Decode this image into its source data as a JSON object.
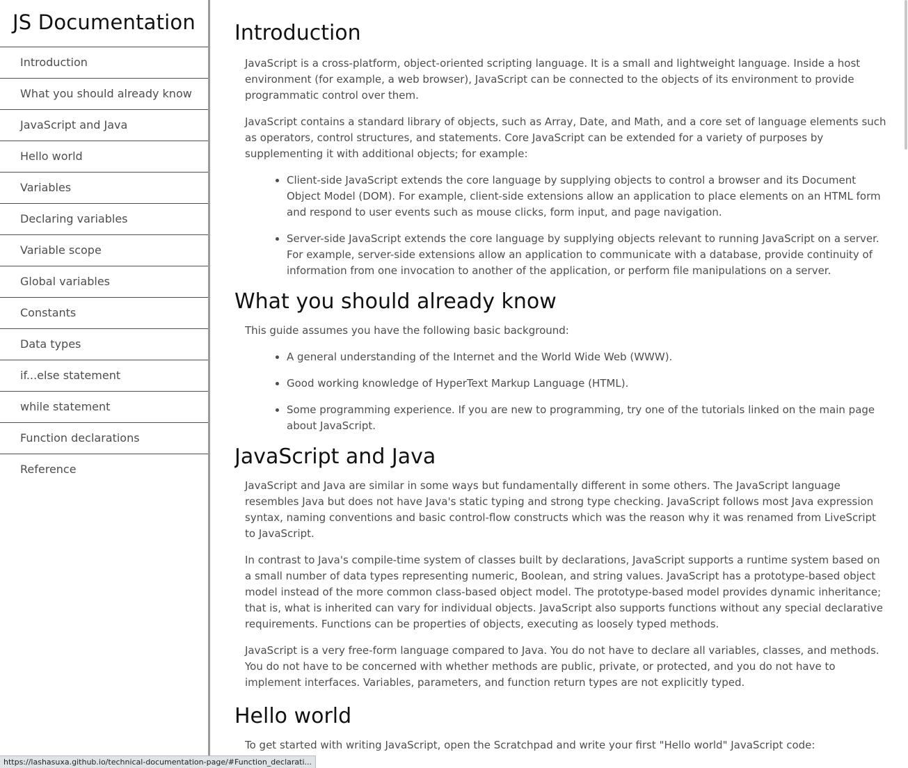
{
  "navbar": {
    "title": "JS Documentation",
    "items": [
      "Introduction",
      "What you should already know",
      "JavaScript and Java",
      "Hello world",
      "Variables",
      "Declaring variables",
      "Variable scope",
      "Global variables",
      "Constants",
      "Data types",
      "if...else statement",
      "while statement",
      "Function declarations",
      "Reference"
    ]
  },
  "sections": {
    "introduction": {
      "heading": "Introduction",
      "p1": "JavaScript is a cross-platform, object-oriented scripting language. It is a small and lightweight language. Inside a host environment (for example, a web browser), JavaScript can be connected to the objects of its environment to provide programmatic control over them.",
      "p2": "JavaScript contains a standard library of objects, such as Array, Date, and Math, and a core set of language elements such as operators, control structures, and statements. Core JavaScript can be extended for a variety of purposes by supplementing it with additional objects; for example:",
      "bullets": [
        "Client-side JavaScript extends the core language by supplying objects to control a browser and its Document Object Model (DOM). For example, client-side extensions allow an application to place elements on an HTML form and respond to user events such as mouse clicks, form input, and page navigation.",
        "Server-side JavaScript extends the core language by supplying objects relevant to running JavaScript on a server. For example, server-side extensions allow an application to communicate with a database, provide continuity of information from one invocation to another of the application, or perform file manipulations on a server."
      ]
    },
    "what_you_should_know": {
      "heading": "What you should already know",
      "p1": "This guide assumes you have the following basic background:",
      "bullets": [
        "A general understanding of the Internet and the World Wide Web (WWW).",
        "Good working knowledge of HyperText Markup Language (HTML).",
        "Some programming experience. If you are new to programming, try one of the tutorials linked on the main page about JavaScript."
      ]
    },
    "javascript_and_java": {
      "heading": "JavaScript and Java",
      "p1": "JavaScript and Java are similar in some ways but fundamentally different in some others. The JavaScript language resembles Java but does not have Java's static typing and strong type checking. JavaScript follows most Java expression syntax, naming conventions and basic control-flow constructs which was the reason why it was renamed from LiveScript to JavaScript.",
      "p2": "In contrast to Java's compile-time system of classes built by declarations, JavaScript supports a runtime system based on a small number of data types representing numeric, Boolean, and string values. JavaScript has a prototype-based object model instead of the more common class-based object model. The prototype-based model provides dynamic inheritance; that is, what is inherited can vary for individual objects. JavaScript also supports functions without any special declarative requirements. Functions can be properties of objects, executing as loosely typed methods.",
      "p3": "JavaScript is a very free-form language compared to Java. You do not have to declare all variables, classes, and methods. You do not have to be concerned with whether methods are public, private, or protected, and you do not have to implement interfaces. Variables, parameters, and function return types are not explicitly typed."
    },
    "hello_world": {
      "heading": "Hello world",
      "p1": "To get started with writing JavaScript, open the Scratchpad and write your first \"Hello world\" JavaScript code:"
    }
  },
  "status_bar": {
    "url": "https://lashasuxa.github.io/technical-documentation-page/#Function_declarati..."
  }
}
